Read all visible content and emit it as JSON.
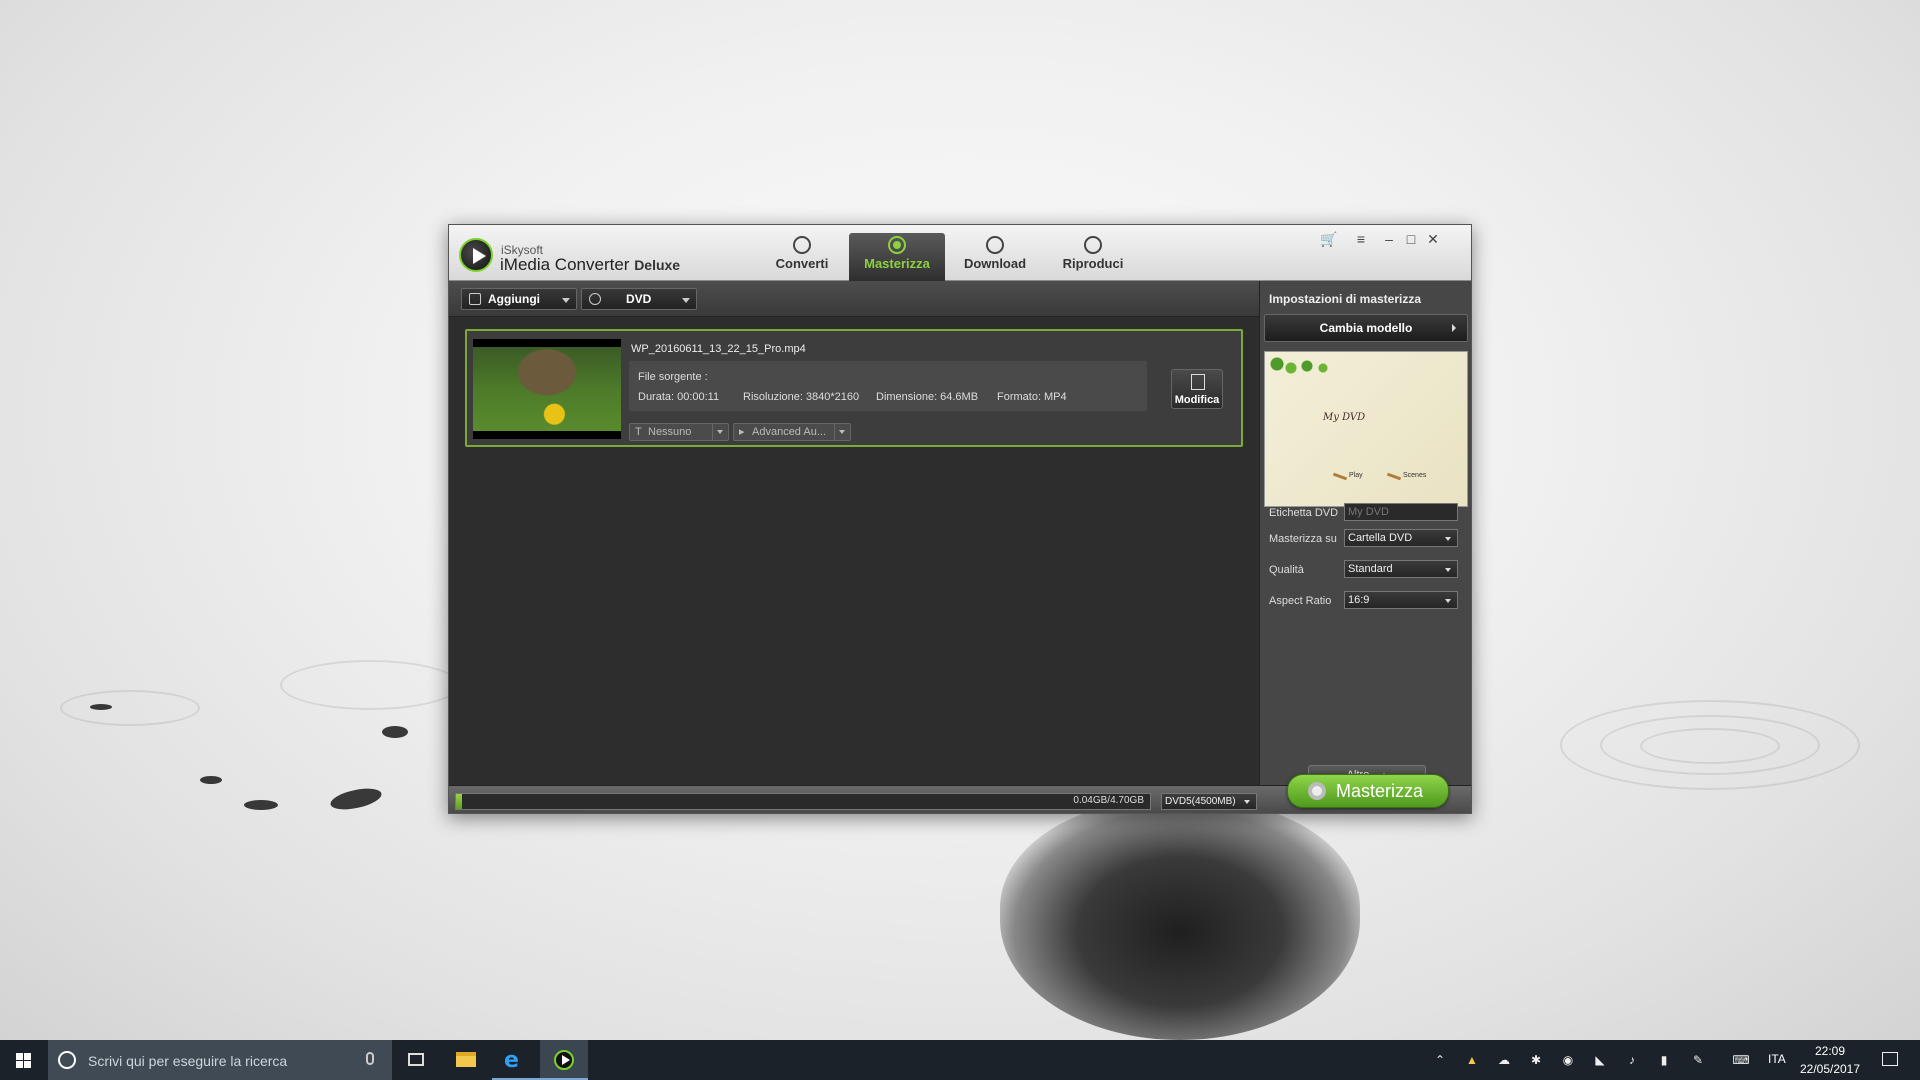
{
  "app": {
    "brand_small": "iSkysoft",
    "brand_name": "iMedia Converter",
    "brand_edition": "Deluxe"
  },
  "nav_tabs": [
    {
      "label": "Converti",
      "icon": "refresh-icon"
    },
    {
      "label": "Masterizza",
      "icon": "burn-disc-icon",
      "active": true
    },
    {
      "label": "Download",
      "icon": "download-icon"
    },
    {
      "label": "Riproduci",
      "icon": "play-icon"
    }
  ],
  "toolbar": {
    "add_label": "Aggiungi",
    "dvd_label": "DVD"
  },
  "file": {
    "name": "WP_20160611_13_22_15_Pro.mp4",
    "source_label": "File sorgente :",
    "duration_label": "Durata:",
    "duration": "00:00:11",
    "resolution_label": "Risoluzione:",
    "resolution": "3840*2160",
    "size_label": "Dimensione:",
    "size": "64.6MB",
    "format_label": "Formato:",
    "format": "MP4",
    "edit_label": "Modifica",
    "subtitle_value": "Nessuno",
    "audio_value": "Advanced Au..."
  },
  "panel": {
    "title": "Impostazioni di masterizza",
    "template_button": "Cambia modello",
    "preview_title": "My DVD",
    "preview_play": "Play",
    "preview_scenes": "Scenes",
    "dvd_label_label": "Etichetta DVD",
    "dvd_label_placeholder": "My DVD",
    "burn_to_label": "Masterizza su",
    "burn_to_value": "Cartella DVD",
    "quality_label": "Qualità",
    "quality_value": "Standard",
    "aspect_label": "Aspect Ratio",
    "aspect_value": "16:9",
    "more_label": "Altro"
  },
  "bottom": {
    "capacity_text": "0.04GB/4.70GB",
    "progress_fraction": 0.009,
    "disc_type": "DVD5(4500MB)",
    "burn_button": "Masterizza"
  },
  "taskbar": {
    "search_placeholder": "Scrivi qui per eseguire la ricerca",
    "language": "ITA",
    "time": "22:09",
    "date": "22/05/2017"
  },
  "colors": {
    "accent": "#8dd13c",
    "window_bg": "#2f2f2f",
    "taskbar_bg": "#1b2229"
  }
}
